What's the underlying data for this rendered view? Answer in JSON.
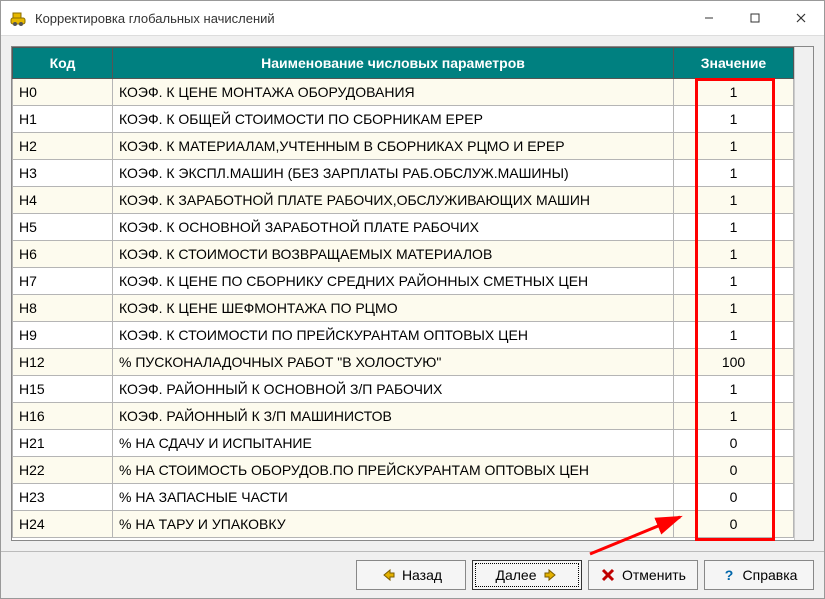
{
  "window": {
    "title": "Корректировка глобальных начислений"
  },
  "table": {
    "headers": {
      "code": "Код",
      "name": "Наименование числовых параметров",
      "value": "Значение"
    },
    "rows": [
      {
        "code": "Н0",
        "name": "КОЭФ. К ЦЕНЕ МОНТАЖА ОБОРУДОВАНИЯ",
        "value": "1"
      },
      {
        "code": "Н1",
        "name": "КОЭФ. К ОБЩЕЙ СТОИМОСТИ ПО СБОРНИКАМ ЕРЕР",
        "value": "1"
      },
      {
        "code": "Н2",
        "name": "КОЭФ. К МАТЕРИАЛАМ,УЧТЕННЫМ В СБОРНИКАХ РЦМО И ЕРЕР",
        "value": "1"
      },
      {
        "code": "Н3",
        "name": "КОЭФ. К ЭКСПЛ.МАШИН (БЕЗ ЗАРПЛАТЫ РАБ.ОБСЛУЖ.МАШИНЫ)",
        "value": "1"
      },
      {
        "code": "Н4",
        "name": "КОЭФ. К ЗАРАБОТНОЙ ПЛАТЕ РАБОЧИХ,ОБСЛУЖИВАЮЩИХ МАШИН",
        "value": "1"
      },
      {
        "code": "Н5",
        "name": "КОЭФ. К ОСНОВНОЙ ЗАРАБОТНОЙ ПЛАТЕ РАБОЧИХ",
        "value": "1"
      },
      {
        "code": "Н6",
        "name": "КОЭФ. К СТОИМОСТИ ВОЗВРАЩАЕМЫХ МАТЕРИАЛОВ",
        "value": "1"
      },
      {
        "code": "Н7",
        "name": "КОЭФ. К ЦЕНЕ ПО СБОРНИКУ СРЕДНИХ РАЙОННЫХ СМЕТНЫХ ЦЕН",
        "value": "1"
      },
      {
        "code": "Н8",
        "name": "КОЭФ. К ЦЕНЕ ШЕФМОНТАЖА ПО РЦМО",
        "value": "1"
      },
      {
        "code": "Н9",
        "name": "КОЭФ. К СТОИМОСТИ ПО ПРЕЙСКУРАНТАМ ОПТОВЫХ ЦЕН",
        "value": "1"
      },
      {
        "code": "Н12",
        "name": "% ПУСКОНАЛАДОЧНЫХ РАБОТ \"В ХОЛОСТУЮ\"",
        "value": "100"
      },
      {
        "code": "Н15",
        "name": "КОЭФ. РАЙОННЫЙ К ОСНОВНОЙ З/П РАБОЧИХ",
        "value": "1"
      },
      {
        "code": "Н16",
        "name": "КОЭФ. РАЙОННЫЙ К З/П МАШИНИСТОВ",
        "value": "1"
      },
      {
        "code": "Н21",
        "name": "% НА СДАЧУ И ИСПЫТАНИЕ",
        "value": "0"
      },
      {
        "code": "Н22",
        "name": "% НА СТОИМОСТЬ ОБОРУДОВ.ПО ПРЕЙСКУРАНТАМ ОПТОВЫХ ЦЕН",
        "value": "0"
      },
      {
        "code": "Н23",
        "name": "% НА ЗАПАСНЫЕ ЧАСТИ",
        "value": "0"
      },
      {
        "code": "Н24",
        "name": "% НА ТАРУ И УПАКОВКУ",
        "value": "0"
      }
    ]
  },
  "buttons": {
    "back": "Назад",
    "next": "Далее",
    "cancel": "Отменить",
    "help": "Справка"
  },
  "annotation": {
    "highlight_color": "#ff0000"
  }
}
